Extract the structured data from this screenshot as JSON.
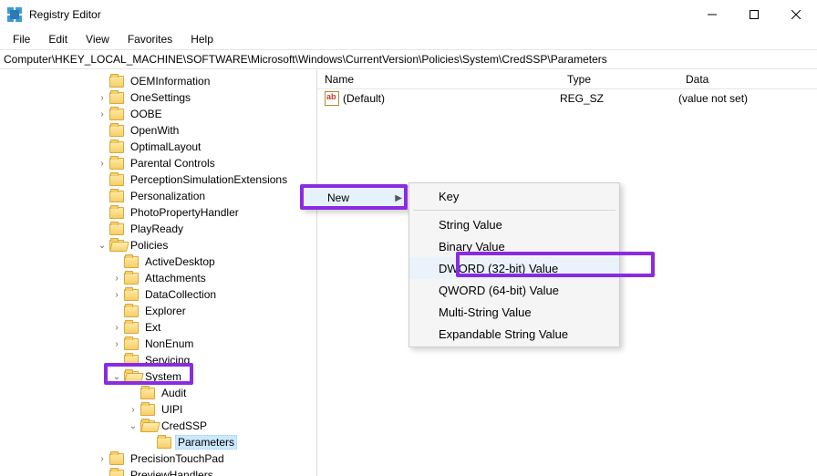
{
  "titlebar": {
    "app_title": "Registry Editor"
  },
  "menu": {
    "file": "File",
    "edit": "Edit",
    "view": "View",
    "favorites": "Favorites",
    "help": "Help"
  },
  "address": "Computer\\HKEY_LOCAL_MACHINE\\SOFTWARE\\Microsoft\\Windows\\CurrentVersion\\Policies\\System\\CredSSP\\Parameters",
  "tree": [
    {
      "depth": 6,
      "twisty": "",
      "label": "OEMInformation"
    },
    {
      "depth": 6,
      "twisty": ">",
      "label": "OneSettings"
    },
    {
      "depth": 6,
      "twisty": ">",
      "label": "OOBE"
    },
    {
      "depth": 6,
      "twisty": "",
      "label": "OpenWith"
    },
    {
      "depth": 6,
      "twisty": "",
      "label": "OptimalLayout"
    },
    {
      "depth": 6,
      "twisty": ">",
      "label": "Parental Controls"
    },
    {
      "depth": 6,
      "twisty": "",
      "label": "PerceptionSimulationExtensions"
    },
    {
      "depth": 6,
      "twisty": "",
      "label": "Personalization"
    },
    {
      "depth": 6,
      "twisty": "",
      "label": "PhotoPropertyHandler"
    },
    {
      "depth": 6,
      "twisty": "",
      "label": "PlayReady"
    },
    {
      "depth": 6,
      "twisty": "v",
      "label": "Policies",
      "open": true
    },
    {
      "depth": 7,
      "twisty": "",
      "label": "ActiveDesktop"
    },
    {
      "depth": 7,
      "twisty": ">",
      "label": "Attachments"
    },
    {
      "depth": 7,
      "twisty": ">",
      "label": "DataCollection"
    },
    {
      "depth": 7,
      "twisty": "",
      "label": "Explorer"
    },
    {
      "depth": 7,
      "twisty": ">",
      "label": "Ext"
    },
    {
      "depth": 7,
      "twisty": ">",
      "label": "NonEnum"
    },
    {
      "depth": 7,
      "twisty": "",
      "label": "Servicing"
    },
    {
      "depth": 7,
      "twisty": "v",
      "label": "System",
      "open": true
    },
    {
      "depth": 8,
      "twisty": "",
      "label": "Audit"
    },
    {
      "depth": 8,
      "twisty": ">",
      "label": "UIPI"
    },
    {
      "depth": 8,
      "twisty": "v",
      "label": "CredSSP",
      "open": true
    },
    {
      "depth": 9,
      "twisty": "",
      "label": "Parameters",
      "selected": true
    },
    {
      "depth": 6,
      "twisty": ">",
      "label": "PrecisionTouchPad"
    },
    {
      "depth": 6,
      "twisty": "",
      "label": "PreviewHandlers"
    }
  ],
  "columns": {
    "name": "Name",
    "type": "Type",
    "data": "Data"
  },
  "values": [
    {
      "name": "(Default)",
      "type": "REG_SZ",
      "data": "(value not set)"
    }
  ],
  "context_menu": {
    "parent": {
      "label": "New"
    },
    "sub": [
      {
        "label": "Key"
      },
      {
        "sep": true
      },
      {
        "label": "String Value"
      },
      {
        "label": "Binary Value"
      },
      {
        "label": "DWORD (32-bit) Value",
        "hot": true
      },
      {
        "label": "QWORD (64-bit) Value"
      },
      {
        "label": "Multi-String Value"
      },
      {
        "label": "Expandable String Value"
      }
    ]
  }
}
